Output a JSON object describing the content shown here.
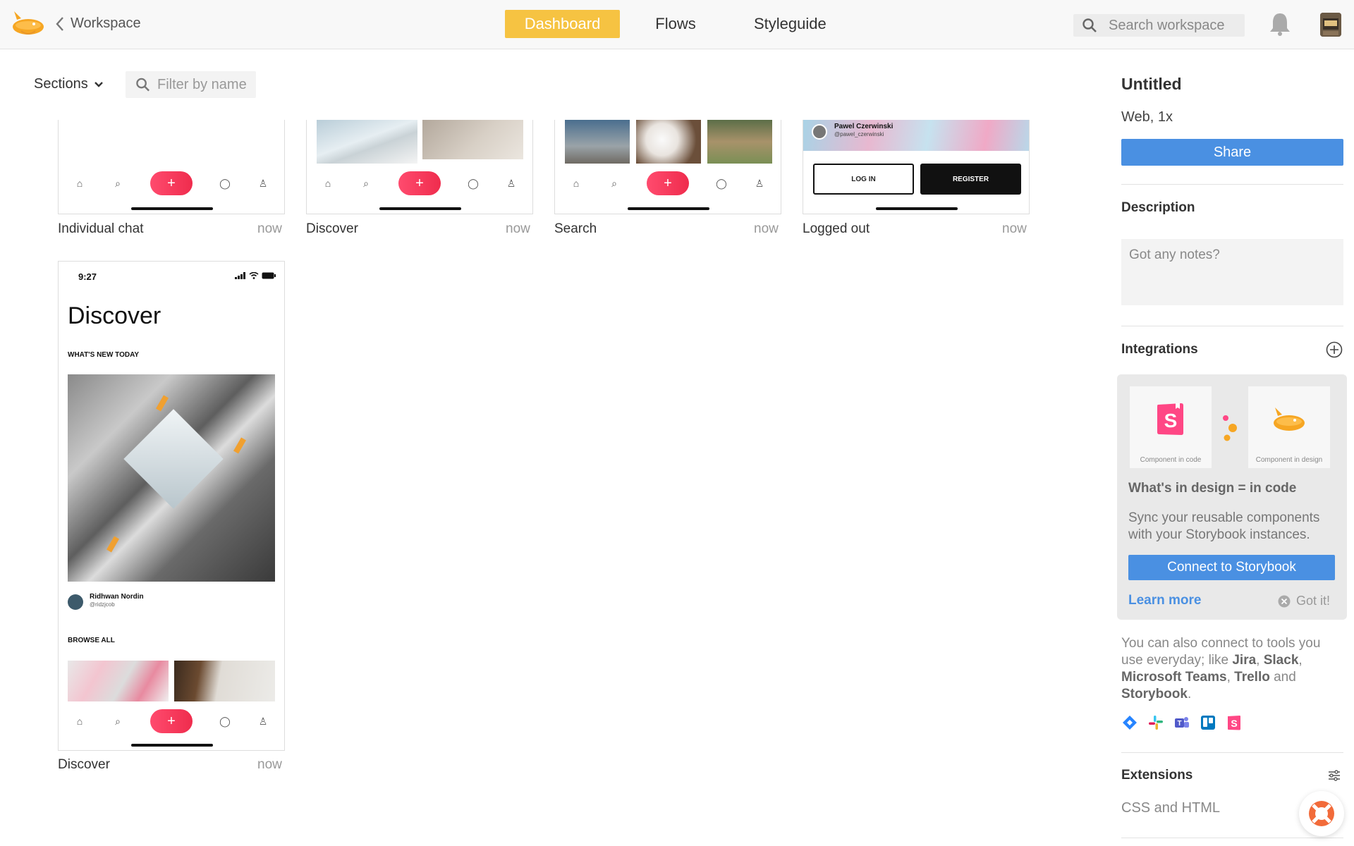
{
  "topbar": {
    "back_label": "Workspace",
    "tabs": [
      {
        "label": "Dashboard",
        "active": true
      },
      {
        "label": "Flows",
        "active": false
      },
      {
        "label": "Styleguide",
        "active": false
      }
    ],
    "search_placeholder": "Search workspace",
    "accent": "#f6c342"
  },
  "toolbar": {
    "sections_label": "Sections",
    "filter_placeholder": "Filter by name"
  },
  "screens": [
    {
      "name": "Individual chat",
      "time": "now"
    },
    {
      "name": "Discover",
      "time": "now"
    },
    {
      "name": "Search",
      "time": "now"
    },
    {
      "name": "Logged out",
      "time": "now",
      "profile_name": "Pawel Czerwinski",
      "profile_handle": "@pawel_czerwinski",
      "login_label": "LOG IN",
      "register_label": "REGISTER"
    },
    {
      "name": "Discover",
      "time": "now",
      "status_time": "9:27",
      "heading": "Discover",
      "section1": "WHAT'S NEW TODAY",
      "author": "Ridhwan Nordin",
      "author_handle": "@ridzjcob",
      "section2": "BROWSE ALL"
    }
  ],
  "panel": {
    "title": "Untitled",
    "subtitle": "Web, 1x",
    "share_label": "Share",
    "description_label": "Description",
    "notes_placeholder": "Got any notes?",
    "integrations_label": "Integrations",
    "tile1_caption": "Component in code",
    "tile2_caption": "Component in design",
    "intg_heading": "What's in design = in code",
    "intg_text": "Sync your reusable components with your Storybook instances.",
    "connect_label": "Connect to Storybook",
    "learn_more": "Learn more",
    "got_it": "Got it!",
    "also_prefix": "You can also connect to tools you use everyday; like ",
    "tool_jira": "Jira",
    "tool_slack": "Slack",
    "tool_teams": "Microsoft Teams",
    "tool_trello": "Trello",
    "and_word": " and ",
    "tool_storybook": "Storybook",
    "extensions_label": "Extensions",
    "css_html": "CSS and HTML",
    "primary_color": "#4a90e2"
  }
}
